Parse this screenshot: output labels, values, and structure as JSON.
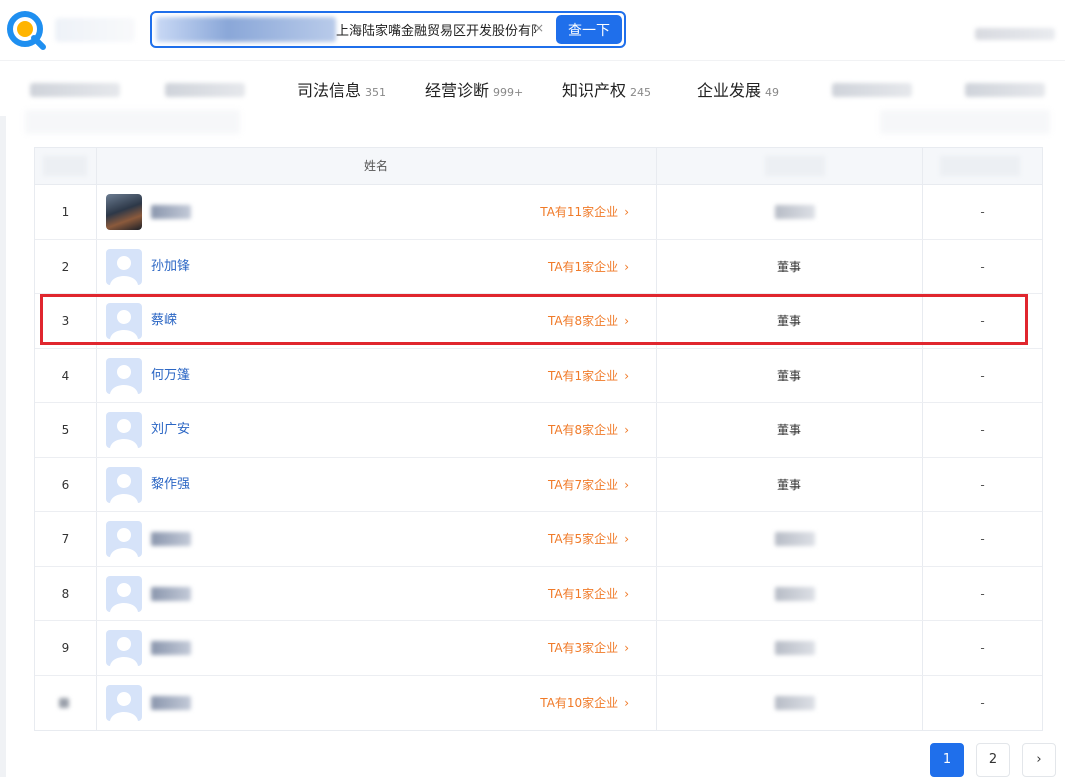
{
  "header": {
    "search_value": "上海陆家嘴金融贸易区开发股份有限",
    "search_button": "查一下",
    "clear_icon": "×",
    "colors": {
      "brand": "#1f6feb",
      "accent": "#f07a28",
      "highlight": "#e0262e"
    }
  },
  "tabs": [
    {
      "label": "司法信息",
      "count": "351"
    },
    {
      "label": "经营诊断",
      "count": "999+"
    },
    {
      "label": "知识产权",
      "count": "245"
    },
    {
      "label": "企业发展",
      "count": "49"
    }
  ],
  "table": {
    "header_name": "姓名",
    "rows": [
      {
        "index": "1",
        "name": "",
        "company": "TA有11家企业",
        "role": "",
        "extra": "-"
      },
      {
        "index": "2",
        "name": "孙加锋",
        "company": "TA有1家企业",
        "role": "董事",
        "extra": "-"
      },
      {
        "index": "3",
        "name": "蔡嵘",
        "company": "TA有8家企业",
        "role": "董事",
        "extra": "-"
      },
      {
        "index": "4",
        "name": "何万篷",
        "company": "TA有1家企业",
        "role": "董事",
        "extra": "-"
      },
      {
        "index": "5",
        "name": "刘广安",
        "company": "TA有8家企业",
        "role": "董事",
        "extra": "-"
      },
      {
        "index": "6",
        "name": "黎作强",
        "company": "TA有7家企业",
        "role": "董事",
        "extra": "-"
      },
      {
        "index": "7",
        "name": "",
        "company": "TA有5家企业",
        "role": "",
        "extra": "-"
      },
      {
        "index": "8",
        "name": "",
        "company": "TA有1家企业",
        "role": "",
        "extra": "-"
      },
      {
        "index": "9",
        "name": "",
        "company": "TA有3家企业",
        "role": "",
        "extra": "-"
      },
      {
        "index": "",
        "name": "",
        "company": "TA有10家企业",
        "role": "",
        "extra": "-"
      }
    ]
  },
  "pagination": {
    "pages": [
      "1",
      "2"
    ],
    "next": "›",
    "current": "1"
  }
}
